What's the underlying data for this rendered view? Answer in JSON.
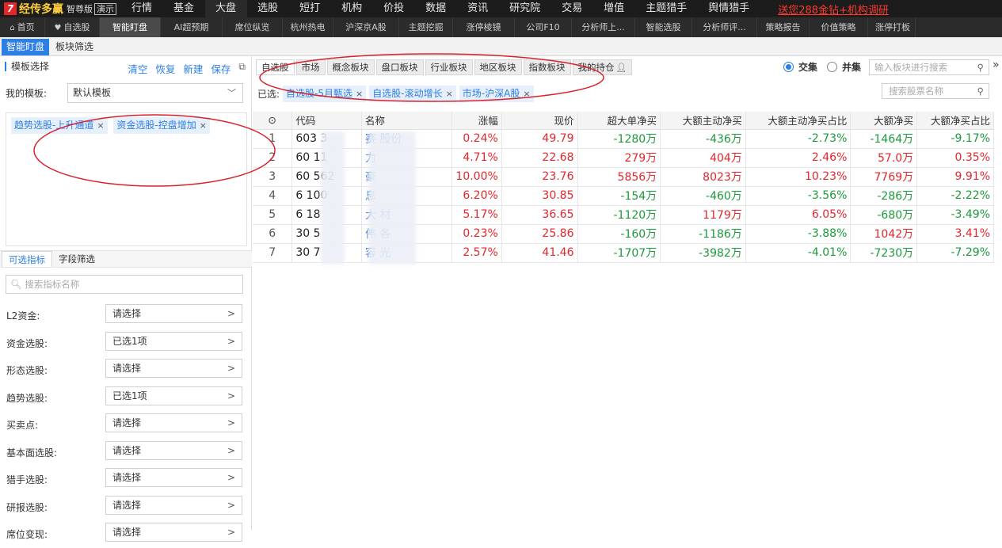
{
  "topbar": {
    "logo_mark": "7",
    "logo_name": "经传多赢",
    "edition": "智尊版",
    "demo": "演示",
    "menu": [
      {
        "label": "行情",
        "dot": true
      },
      {
        "label": "基金",
        "dot": false
      },
      {
        "label": "大盘",
        "dot": false
      },
      {
        "label": "选股",
        "dot": false
      },
      {
        "label": "短打",
        "dot": false
      },
      {
        "label": "机构",
        "dot": false
      },
      {
        "label": "价投",
        "dot": false
      },
      {
        "label": "数据",
        "dot": false
      },
      {
        "label": "资讯",
        "dot": false
      },
      {
        "label": "研究院",
        "dot": false
      },
      {
        "label": "交易",
        "dot": false
      },
      {
        "label": "增值",
        "dot": true
      },
      {
        "label": "主题猎手",
        "dot": false
      },
      {
        "label": "舆情猎手",
        "dot": false
      }
    ],
    "promo": "送您288金钻+机构调研"
  },
  "subnav": {
    "items": [
      "首页",
      "自选股",
      "智能盯盘",
      "AI超预期",
      "席位纵览",
      "杭州热电",
      "沪深京A股",
      "主题挖掘",
      "涨停棱镜",
      "公司F10",
      "分析师上...",
      "智能选股",
      "分析师评...",
      "策略报告",
      "价值策略",
      "涨停打板"
    ],
    "active_index": 2,
    "icons": {
      "0": "home-icon",
      "1": "heart-icon"
    }
  },
  "functabs": {
    "items": [
      "智能盯盘",
      "板块筛选"
    ],
    "active_index": 0
  },
  "left": {
    "title": "模板选择",
    "actions": [
      "清空",
      "恢复",
      "新建",
      "保存"
    ],
    "my_template_label": "我的模板:",
    "my_template_value": "默认模板",
    "chips": [
      "趋势选股-上升通道",
      "资金选股-控盘增加"
    ],
    "ind_tabs": [
      "可选指标",
      "字段筛选"
    ],
    "ind_search_placeholder": "搜索指标名称",
    "indicators": [
      {
        "label": "L2资金:",
        "value": "请选择"
      },
      {
        "label": "资金选股:",
        "value": "已选1项"
      },
      {
        "label": "形态选股:",
        "value": "请选择"
      },
      {
        "label": "趋势选股:",
        "value": "已选1项"
      },
      {
        "label": "买卖点:",
        "value": "请选择"
      },
      {
        "label": "基本面选股:",
        "value": "请选择"
      },
      {
        "label": "猎手选股:",
        "value": "请选择"
      },
      {
        "label": "研报选股:",
        "value": "请选择"
      },
      {
        "label": "席位变现:",
        "value": "请选择"
      }
    ]
  },
  "right": {
    "source_tabs": [
      "自选股",
      "市场",
      "概念板块",
      "盘口板块",
      "行业板块",
      "地区板块",
      "指数板块",
      "我的持仓"
    ],
    "mode": {
      "intersection": "交集",
      "union": "并集",
      "selected": "intersection"
    },
    "block_search_placeholder": "输入板块进行搜索",
    "selected_label": "已选:",
    "selected_chips": [
      "自选股-5月甄选",
      "自选股-滚动增长",
      "市场-沪深A股"
    ],
    "stock_search_placeholder": "搜索股票名称",
    "columns": [
      "代码",
      "名称",
      "涨幅",
      "现价",
      "超大单净买",
      "大额主动净买",
      "大额主动净买占比",
      "大额净买",
      "大额净买占比"
    ],
    "rows": [
      {
        "idx": "1",
        "code": "603 3",
        "name": "赛 股份",
        "chg": "0.24%",
        "price": "49.79",
        "xl": "-1280万",
        "la": "-436万",
        "la_pct": "-2.73%",
        "ln": "-1464万",
        "ln_pct": "-9.17%",
        "dir": [
          "up",
          "up",
          "down",
          "down",
          "down",
          "down",
          "down"
        ]
      },
      {
        "idx": "2",
        "code": "60 11",
        "name": " 力 ",
        "chg": "4.71%",
        "price": "22.68",
        "xl": "279万",
        "la": "404万",
        "la_pct": "2.46%",
        "ln": "57.0万",
        "ln_pct": "0.35%",
        "dir": [
          "up",
          "up",
          "up",
          "up",
          "up",
          "up",
          "up"
        ]
      },
      {
        "idx": "3",
        "code": "60 562",
        "name": " 豪",
        "chg": "10.00%",
        "price": "23.76",
        "xl": "5856万",
        "la": "8023万",
        "la_pct": "10.23%",
        "ln": "7769万",
        "ln_pct": "9.91%",
        "dir": [
          "up",
          "up",
          "up",
          "up",
          "up",
          "up",
          "up"
        ]
      },
      {
        "idx": "4",
        "code": "6 100",
        "name": " 息",
        "chg": "6.20%",
        "price": "30.85",
        "xl": "-154万",
        "la": "-460万",
        "la_pct": "-3.56%",
        "ln": "-286万",
        "ln_pct": "-2.22%",
        "dir": [
          "up",
          "up",
          "down",
          "down",
          "down",
          "down",
          "down"
        ]
      },
      {
        "idx": "5",
        "code": "6 18",
        "name": " 大 材",
        "chg": "5.17%",
        "price": "36.65",
        "xl": "-1120万",
        "la": "1179万",
        "la_pct": "6.05%",
        "ln": "-680万",
        "ln_pct": "-3.49%",
        "dir": [
          "up",
          "up",
          "down",
          "up",
          "up",
          "down",
          "down"
        ]
      },
      {
        "idx": "6",
        "code": "30 5",
        "name": " 伟 各",
        "chg": "0.23%",
        "price": "25.86",
        "xl": "-160万",
        "la": "-1186万",
        "la_pct": "-3.88%",
        "ln": "1042万",
        "ln_pct": "3.41%",
        "dir": [
          "up",
          "up",
          "down",
          "down",
          "down",
          "up",
          "up"
        ]
      },
      {
        "idx": "7",
        "code": "30 7",
        "name": "容 光",
        "chg": "2.57%",
        "price": "41.46",
        "xl": "-1707万",
        "la": "-3982万",
        "la_pct": "-4.01%",
        "ln": "-7230万",
        "ln_pct": "-7.29%",
        "dir": [
          "up",
          "up",
          "down",
          "down",
          "down",
          "down",
          "down"
        ]
      }
    ]
  },
  "colors": {
    "accent": "#2d7ee5",
    "up": "#e4262d",
    "down": "#1c9a3c",
    "annotation": "#d9212c"
  }
}
